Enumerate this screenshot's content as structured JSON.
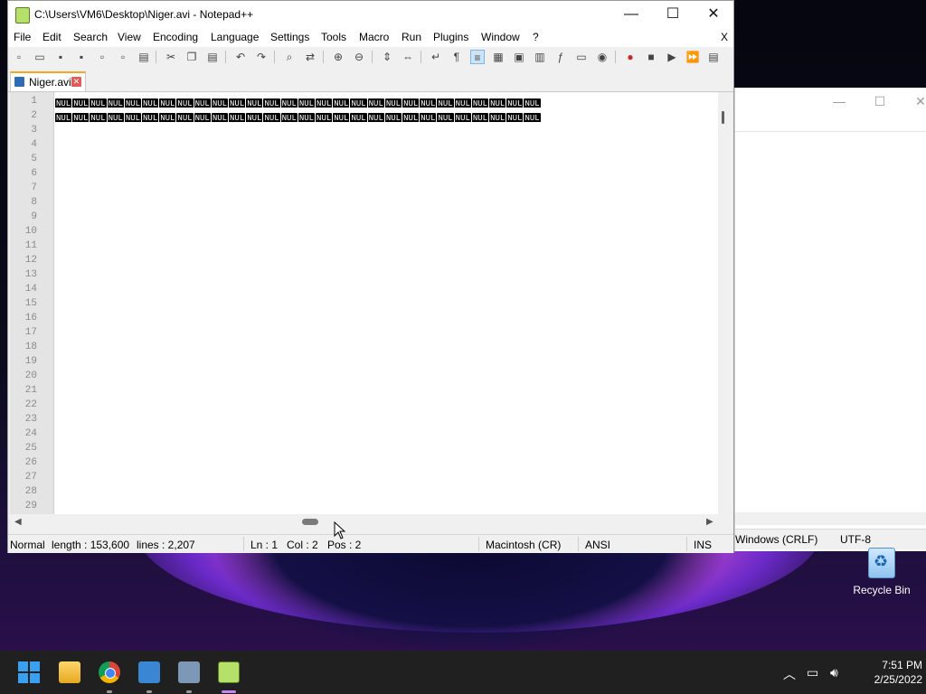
{
  "window": {
    "title": "C:\\Users\\VM6\\Desktop\\Niger.avi - Notepad++",
    "minimize": "—",
    "maximize": "☐",
    "close": "✕"
  },
  "menu": [
    "File",
    "Edit",
    "Search",
    "View",
    "Encoding",
    "Language",
    "Settings",
    "Tools",
    "Macro",
    "Run",
    "Plugins",
    "Window",
    "?"
  ],
  "menu_close": "X",
  "tab": {
    "label": "Niger.avi",
    "close": "✕"
  },
  "editor": {
    "line_numbers": [
      "1",
      "2",
      "3",
      "4",
      "5",
      "6",
      "7",
      "8",
      "9",
      "10",
      "11",
      "12",
      "13",
      "14",
      "15",
      "16",
      "17",
      "18",
      "19",
      "20",
      "21",
      "22",
      "23",
      "24",
      "25",
      "26",
      "27",
      "28",
      "29"
    ],
    "nul_token": "NUL"
  },
  "status": {
    "mode": "Normal",
    "length": "length : 153,600",
    "lines": "lines : 2,207",
    "ln": "Ln : 1",
    "col": "Col : 2",
    "pos": "Pos : 2",
    "eol": "Macintosh (CR)",
    "encoding": "ANSI",
    "ins": "INS"
  },
  "background_window": {
    "eol": "Windows (CRLF)",
    "encoding": "UTF-8"
  },
  "desktop": {
    "recycle_bin": "Recycle Bin"
  },
  "taskbar": {
    "time": "7:51 PM",
    "date": "2/25/2022",
    "apps": [
      "start-icon",
      "file-explorer-icon",
      "chrome-icon",
      "notepad-icon",
      "app-icon",
      "notepadpp-icon"
    ]
  },
  "colors": {
    "tab_accent": "#f5a623",
    "taskbar": "#202020",
    "active_indicator": "#c386f1"
  }
}
